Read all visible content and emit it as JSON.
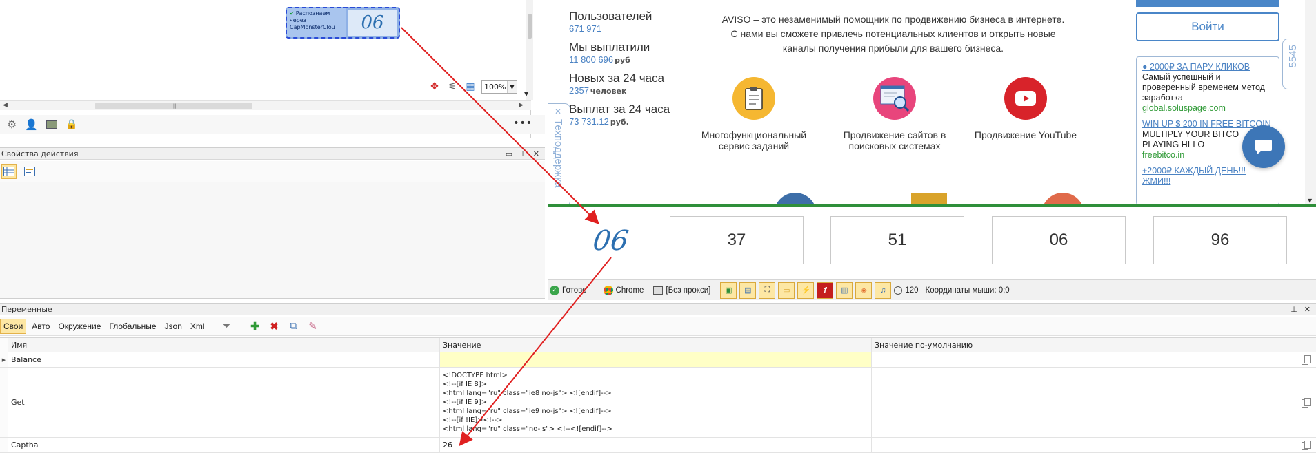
{
  "canvas": {
    "action_block": {
      "text": "Распознаем через CapMonsterClou",
      "captcha_text": "06"
    },
    "zoom": {
      "value": "100%"
    }
  },
  "props_panel": {
    "title": "Свойства действия"
  },
  "browser": {
    "stats": [
      {
        "label": "Пользователей",
        "value": "671 971",
        "unit": ""
      },
      {
        "label": "Мы выплатили",
        "value": "11 800 696",
        "unit": "руб"
      },
      {
        "label": "Новых за 24 часа",
        "value": "2357",
        "unit": "человек"
      },
      {
        "label": "Выплат за 24 часа",
        "value": "73 731.12",
        "unit": "руб."
      }
    ],
    "support_tab": "Техподдержка",
    "about": "AVISO – это незаменимый помощник по продвижению бизнеса в интернете. С нами вы сможете привлечь потенциальных клиентов и открыть новые каналы получения прибыли для вашего бизнеса.",
    "services": [
      {
        "label": "Многофункциональный сервис заданий",
        "icon": "clipboard-icon",
        "color": "#f5b731"
      },
      {
        "label": "Продвижение сайтов в поисковых системах",
        "icon": "seo-search-icon",
        "color": "#e8457c"
      },
      {
        "label": "Продвижение YouTube",
        "icon": "youtube-icon",
        "color": "#d8232a"
      }
    ],
    "login_label": "Войти",
    "ads": [
      {
        "headline": "● 2000₽ ЗА ПАРУ КЛИКОВ",
        "desc": "Самый успешный и проверенный временем метод заработка",
        "url": "global.soluspage.com"
      },
      {
        "headline": "WIN UP $ 200 IN FREE BITCOIN",
        "desc": "MULTIPLY YOUR BITCO PLAYING HI-LO",
        "url": "freebitco.in"
      },
      {
        "headline": "+2000₽ КАЖДЫЙ ДЕНЬ!!! ЖМИ!!!",
        "desc": "",
        "url": ""
      }
    ],
    "side_counter": "5545",
    "captcha": {
      "image_text": "06",
      "options": [
        "37",
        "51",
        "06",
        "96"
      ]
    },
    "status": {
      "ready": "Готово",
      "browser": "Chrome",
      "proxy": "[Без прокси]",
      "count": "120",
      "mouse": "Координаты мыши: 0;0"
    }
  },
  "variables": {
    "title": "Переменные",
    "tabs": [
      "Свои",
      "Авто",
      "Окружение",
      "Глобальные",
      "Json",
      "Xml"
    ],
    "columns": [
      "Имя",
      "Значение",
      "Значение по-умолчанию"
    ],
    "rows": [
      {
        "name": "Balance",
        "value": "",
        "default": ""
      },
      {
        "name": "Get",
        "value": "<!DOCTYPE html>\n<!--[if IE 8]>\n<html lang=\"ru\" class=\"ie8 no-js\"> <![endif]-->\n<!--[if IE 9]>\n<html lang=\"ru\" class=\"ie9 no-js\"> <![endif]-->\n<!--[if !IE]><!-->\n<html lang=\"ru\" class=\"no-js\"> <!--<![endif]-->",
        "default": ""
      },
      {
        "name": "Captha",
        "value": "26",
        "default": ""
      }
    ]
  },
  "colors": {
    "accent": "#4a86c8",
    "arrow": "#e02020",
    "highlight": "#fde7a4",
    "green_line": "#2f8f3a"
  }
}
